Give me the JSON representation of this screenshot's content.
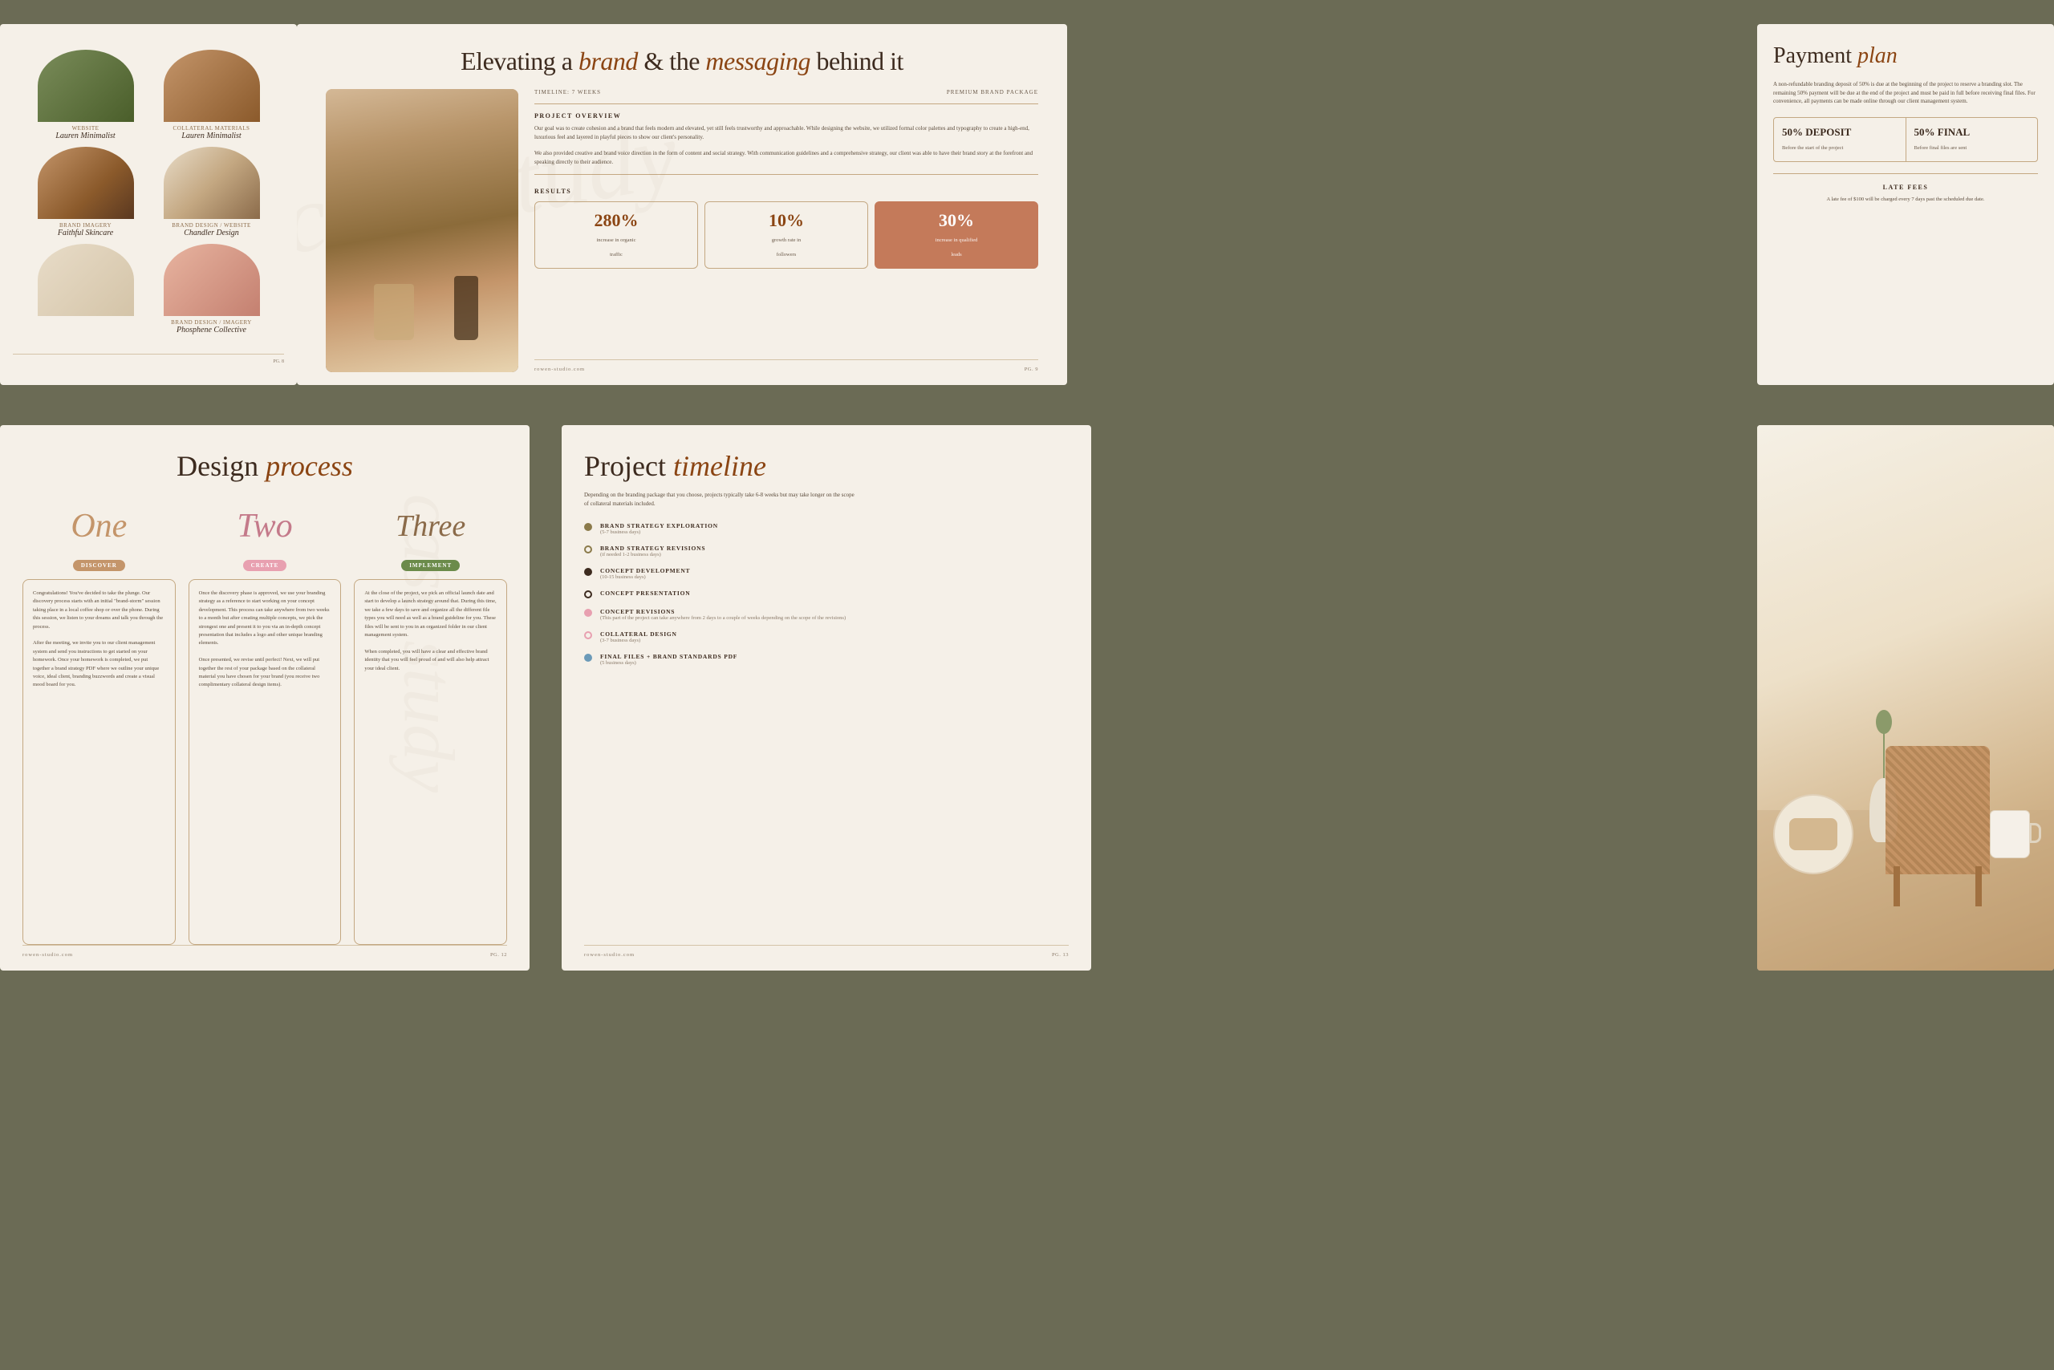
{
  "background_color": "#6b6b55",
  "slides": {
    "slide1": {
      "items": [
        {
          "label_small": "WEBSITE",
          "label_name": "Lauren Minimalist",
          "photo_type": "green-fabric",
          "shape": "arch"
        },
        {
          "label_small": "COLLATERAL MATERIALS",
          "label_name": "Lauren Minimalist",
          "photo_type": "hand-serum",
          "shape": "arch"
        },
        {
          "label_small": "BRAND IMAGERY",
          "label_name": "Faithful Skincare",
          "photo_type": "serum-bottle",
          "shape": "arch"
        },
        {
          "label_small": "BRAND DESIGN / WEBSITE",
          "label_name": "Chandler Design",
          "photo_type": "soap-stack",
          "shape": "arch"
        },
        {
          "label_small": "",
          "label_name": "",
          "photo_type": "design-items",
          "shape": "arch"
        },
        {
          "label_small": "BRAND DESIGN / IMAGERY",
          "label_name": "Phosphene Collective",
          "photo_type": "pink-items",
          "shape": "arch"
        }
      ],
      "page": "PG. 8"
    },
    "slide2": {
      "title_part1": "Elevating a ",
      "title_italic": "brand",
      "title_part2": " & the ",
      "title_italic2": "messaging",
      "title_part3": " behind it",
      "timeline_label": "TIMELINE: 7 WEEKS",
      "package_label": "PREMIUM BRAND PACKAGE",
      "overview_title": "PROJECT OVERVIEW",
      "overview_text1": "Our goal was to create cohesion and a brand that feels modern and elevated, yet still feels trustworthy and approachable. While designing the website, we utilized formal color palettes and typography to create a high-end, luxurious feel and layered in playful pieces to show our client's personality.",
      "overview_text2": "We also provided creative and brand voice direction in the form of content and social strategy. With communication guidelines and a comprehensive strategy, our client was able to have their brand story at the forefront and speaking directly to their audience.",
      "results_title": "RESULTS",
      "results": [
        {
          "number": "280%",
          "label": "increase in organic\ntraffic"
        },
        {
          "number": "10%",
          "label": "growth rate in\nfollowers"
        },
        {
          "number": "30%",
          "label": "increase in qualified\nleads",
          "highlight": true
        }
      ],
      "footer_url": "ROWEN-STUDIO.COM",
      "footer_page": "PG. 9"
    },
    "slide3": {
      "title_part1": "Payment ",
      "title_italic": "plan",
      "body_text": "A non-refundable branding deposit of 50% is due at the beginning of the project to reserve a branding slot. The remaining 50% payment will be due at the end of the project and must be paid in full before receiving final files. For convenience, all payments can be made online through our client management system.",
      "deposit_pct": "50% DEPOSIT",
      "deposit_desc": "Before the start of the project",
      "final_pct": "50% FINAL",
      "final_desc": "Before final files are sent",
      "late_fees_title": "LATE FEES",
      "late_fees_text": "A late fee of $100 will be charged every 7 days past the scheduled due date."
    },
    "slide4": {
      "title_part1": "Design ",
      "title_italic": "process",
      "steps": [
        {
          "number_script": "One",
          "number_class": "one",
          "badge": "DISCOVER",
          "badge_class": "badge-discover",
          "text": "Congratulations! You've decided to take the plunge. Our discovery process starts with an initial \"brand-storm\" session taking place in a local coffee shop or over the phone. During this session, we listen to your dreams and talk you through the process.\n\nAfter the meeting, we invite you to our client management system and send you instructions to get started on your homework. Once your homework is completed, we put together a brand strategy PDF where we outline your unique voice, ideal client, branding buzzwords and create a visual mood board for you."
        },
        {
          "number_script": "Two",
          "number_class": "two",
          "badge": "CREATE",
          "badge_class": "badge-create",
          "text": "Once the discovery phase is approved, we use your branding strategy as a reference to start working on your concept development. This process can take anywhere from two weeks to a month but after creating multiple concepts, we pick the strongest one and present it to you via an in-depth concept presentation that includes a logo and other unique branding elements.\n\nOnce presented, we revise until perfect! Next, we will put together the rest of your package based on the collateral material you have chosen for your brand (you receive two complimentary collateral design items)."
        },
        {
          "number_script": "Three",
          "number_class": "three",
          "badge": "IMPLEMENT",
          "badge_class": "badge-implement",
          "text": "At the close of the project, we pick an official launch date and start to develop a launch strategy around that. During this time, we take a few days to save and organize all the different file types you will need as well as a brand guideline for you. These files will be sent to you in an organized folder in our client management system.\n\nWhen completed, you will have a clear and effective brand identity that you will feel proud of and will also help attract your ideal client."
        }
      ],
      "footer_url": "ROWEN-STUDIO.COM",
      "footer_page": "PG. 12"
    },
    "slide5": {
      "title_part1": "Project ",
      "title_italic": "timeline",
      "subtitle": "Depending on the branding package that you choose, projects typically take 6-8 weeks but may take longer on the scope of collateral materials included.",
      "items": [
        {
          "dot_class": "dot-olive",
          "title": "BRAND STRATEGY EXPLORATION",
          "subtitle": "(5-7 business days)"
        },
        {
          "dot_class": "dot-outline-olive",
          "title": "BRAND STRATEGY REVISIONS",
          "subtitle": "(if needed 1-2 business days)"
        },
        {
          "dot_class": "dot-dark",
          "title": "CONCEPT DEVELOPMENT",
          "subtitle": "(10-15 business days)"
        },
        {
          "dot_class": "dot-outline-dark",
          "title": "CONCEPT PRESENTATION",
          "subtitle": ""
        },
        {
          "dot_class": "dot-pink",
          "title": "CONCEPT REVISIONS",
          "subtitle": "(This part of the project can take anywhere from 2 days to a couple of weeks depending on the scope of the revisions)"
        },
        {
          "dot_class": "dot-outline-pink",
          "title": "COLLATERAL DESIGN",
          "subtitle": "(3-7 business days)"
        },
        {
          "dot_class": "dot-blue",
          "title": "FINAL FILES + BRAND STANDARDS PDF",
          "subtitle": "(5 business days)"
        }
      ],
      "footer_url": "ROWEN-STUDIO.COM",
      "footer_page": "PG. 13"
    }
  }
}
